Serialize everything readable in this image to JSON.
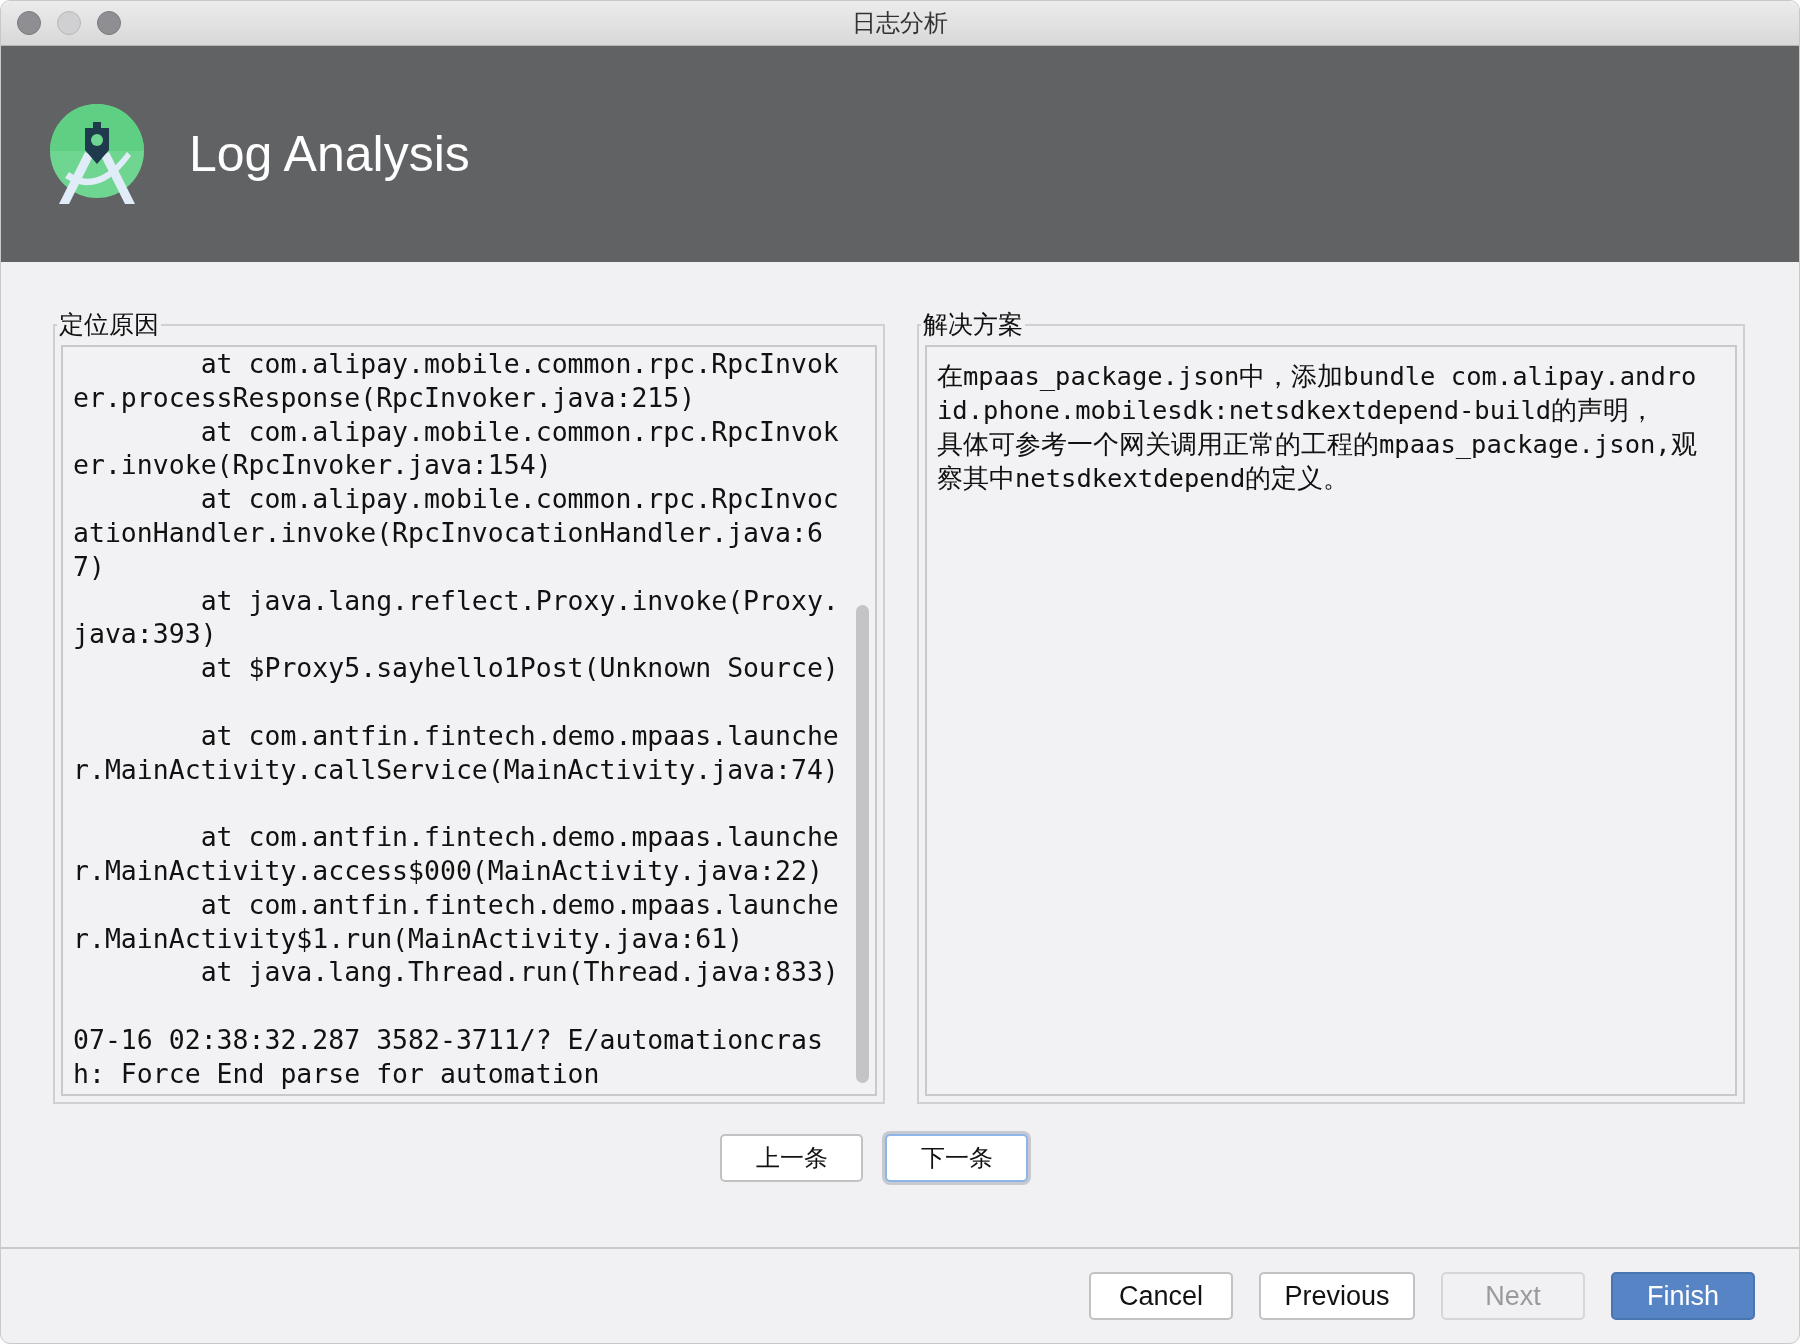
{
  "window": {
    "title": "日志分析"
  },
  "header": {
    "title": "Log Analysis"
  },
  "cause_panel": {
    "legend": "定位原因",
    "log_text": "        at com.alipay.mobile.common.rpc.RpcInvoker.processResponse(RpcInvoker.java:215)\n        at com.alipay.mobile.common.rpc.RpcInvoker.invoke(RpcInvoker.java:154)\n        at com.alipay.mobile.common.rpc.RpcInvocationHandler.invoke(RpcInvocationHandler.java:67)\n        at java.lang.reflect.Proxy.invoke(Proxy.java:393)\n        at $Proxy5.sayhello1Post(Unknown Source)\n\n        at com.antfin.fintech.demo.mpaas.launcher.MainActivity.callService(MainActivity.java:74)\n\n        at com.antfin.fintech.demo.mpaas.launcher.MainActivity.access$000(MainActivity.java:22)\n        at com.antfin.fintech.demo.mpaas.launcher.MainActivity$1.run(MainActivity.java:61)\n        at java.lang.Thread.run(Thread.java:833)\n\n07-16 02:38:32.287 3582-3711/? E/automationcrash: Force End parse for automation"
  },
  "solution_panel": {
    "legend": "解决方案",
    "paragraphs": [
      "在mpaas_package.json中，添加bundle com.alipay.android.phone.mobilesdk:netsdkextdepend-build的声明，",
      "具体可参考一个网关调用正常的工程的mpaas_package.json,观察其中netsdkextdepend的定义。"
    ]
  },
  "nav_buttons": [
    {
      "label": "上一条",
      "focused": false
    },
    {
      "label": "下一条",
      "focused": true
    }
  ],
  "wizard_buttons": [
    {
      "label": "Cancel",
      "disabled": false,
      "primary": false
    },
    {
      "label": "Previous",
      "disabled": false,
      "primary": false
    },
    {
      "label": "Next",
      "disabled": true,
      "primary": false
    },
    {
      "label": "Finish",
      "disabled": false,
      "primary": true
    }
  ]
}
